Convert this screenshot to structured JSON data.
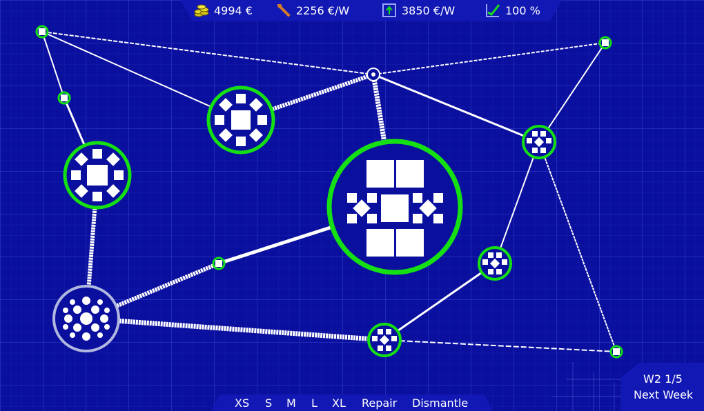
{
  "hud": {
    "money": "4994 €",
    "upkeep": "2256 €/W",
    "income": "3850 €/W",
    "rating": "100 %"
  },
  "toolbar": {
    "xs": "XS",
    "s": "S",
    "m": "M",
    "l": "L",
    "xl": "XL",
    "repair": "Repair",
    "dismantle": "Dismantle"
  },
  "week": {
    "label": "W2 1/5",
    "next": "Next Week"
  },
  "colors": {
    "background": "#0a0f9e",
    "panel": "#1218b4",
    "node_active": "#14e014",
    "node_inactive": "#b0b8e0",
    "link": "#ffffff"
  }
}
